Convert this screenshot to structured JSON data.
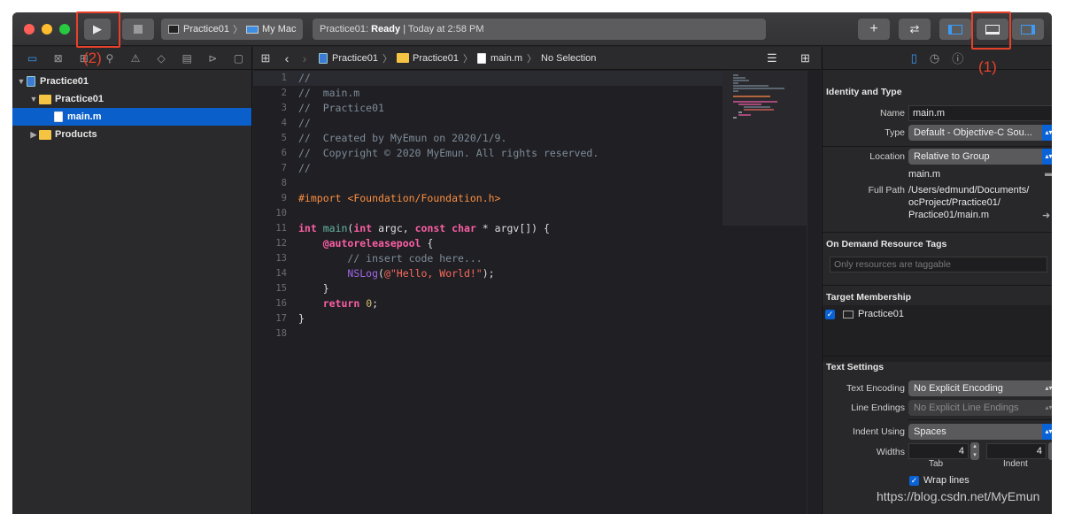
{
  "toolbar": {
    "run_label": "(2)",
    "scheme_name": "Practice01",
    "destination": "My Mac",
    "status_project": "Practice01:",
    "status_state": "Ready",
    "status_time": "| Today at 2:58 PM",
    "annotation_1": "(1)",
    "annotation_2": "(2)"
  },
  "navigator": {
    "items": [
      {
        "label": "Practice01"
      },
      {
        "label": "Practice01"
      },
      {
        "label": "main.m"
      },
      {
        "label": "Products"
      }
    ]
  },
  "jumpbar": {
    "crumbs": [
      "Practice01",
      "Practice01",
      "main.m",
      "No Selection"
    ]
  },
  "code": {
    "lines": [
      "//",
      "//  main.m",
      "//  Practice01",
      "//",
      "//  Created by MyEmun on 2020/1/9.",
      "//  Copyright © 2020 MyEmun. All rights reserved.",
      "//",
      "",
      "#import <Foundation/Foundation.h>",
      "",
      "int main(int argc, const char * argv[]) {",
      "    @autoreleasepool {",
      "        // insert code here...",
      "        NSLog(@\"Hello, World!\");",
      "    }",
      "    return 0;",
      "}",
      ""
    ],
    "line_numbers": [
      "1",
      "2",
      "3",
      "4",
      "5",
      "6",
      "7",
      "8",
      "9",
      "10",
      "11",
      "12",
      "13",
      "14",
      "15",
      "16",
      "17",
      "18"
    ]
  },
  "inspector": {
    "identity_title": "Identity and Type",
    "name_label": "Name",
    "name_value": "main.m",
    "type_label": "Type",
    "type_value": "Default - Objective-C Sou...",
    "location_label": "Location",
    "location_value": "Relative to Group",
    "location_file": "main.m",
    "full_path_label": "Full Path",
    "full_path_value": "/Users/edmund/Documents/ocProject/Practice01/Practice01/main.m",
    "full_path_l1": "/Users/edmund/Documents/",
    "full_path_l2": "ocProject/Practice01/",
    "full_path_l3": "Practice01/main.m",
    "odr_title": "On Demand Resource Tags",
    "odr_placeholder": "Only resources are taggable",
    "target_title": "Target Membership",
    "target_item": "Practice01",
    "text_title": "Text Settings",
    "encoding_label": "Text Encoding",
    "encoding_value": "No Explicit Encoding",
    "line_endings_label": "Line Endings",
    "line_endings_value": "No Explicit Line Endings",
    "indent_using_label": "Indent Using",
    "indent_using_value": "Spaces",
    "widths_label": "Widths",
    "tab_width": "4",
    "indent_width": "4",
    "tab_caption": "Tab",
    "indent_caption": "Indent",
    "wrap_label": "Wrap lines"
  },
  "watermark": "https://blog.csdn.net/MyEmun",
  "colors": {
    "accent": "#0a63d6",
    "annotation": "#e8412a",
    "selection": "#0a5fcb"
  }
}
